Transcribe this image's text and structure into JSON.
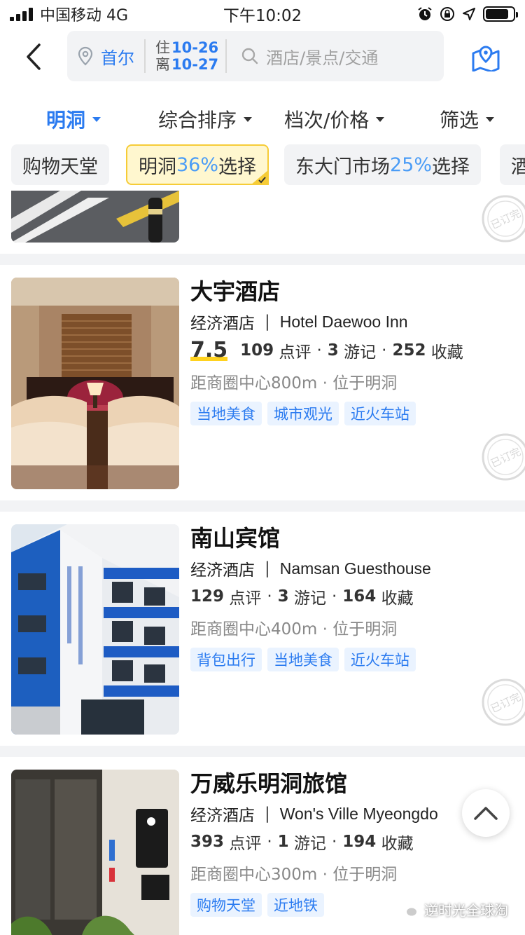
{
  "status_bar": {
    "carrier": "中国移动 4G",
    "time": "下午10:02"
  },
  "nav": {
    "city": "首尔",
    "checkin_label": "住",
    "checkin_date": "10-26",
    "checkout_label": "离",
    "checkout_date": "10-27",
    "search_placeholder": "酒店/景点/交通"
  },
  "filters": [
    {
      "label": "明洞",
      "active": true
    },
    {
      "label": "综合排序",
      "active": false
    },
    {
      "label": "档次/价格",
      "active": false
    },
    {
      "label": "筛选",
      "active": false
    }
  ],
  "chips": [
    {
      "label": "购物天堂"
    },
    {
      "label": "明洞",
      "pct": "36%",
      "suffix": "选择",
      "selected": true
    },
    {
      "label": "东大门市场",
      "pct": "25%",
      "suffix": "选择"
    },
    {
      "label": "酒"
    }
  ],
  "hotels": [
    {
      "name": "大宇酒店",
      "type": "经济酒店",
      "sep": "|",
      "en_name": "Hotel Daewoo Inn",
      "score": "7.5",
      "reviews": "109",
      "reviews_unit": "点评",
      "notes": "3",
      "notes_unit": "游记",
      "favs": "252",
      "favs_unit": "收藏",
      "distance": "距商圈中心800m · 位于明洞",
      "tags": [
        "当地美食",
        "城市观光",
        "近火车站"
      ]
    },
    {
      "name": "南山宾馆",
      "type": "经济酒店",
      "sep": "|",
      "en_name": "Namsan Guesthouse",
      "reviews": "129",
      "reviews_unit": "点评",
      "notes": "3",
      "notes_unit": "游记",
      "favs": "164",
      "favs_unit": "收藏",
      "distance": "距商圈中心400m · 位于明洞",
      "tags": [
        "背包出行",
        "当地美食",
        "近火车站"
      ]
    },
    {
      "name": "万威乐明洞旅馆",
      "type": "经济酒店",
      "sep": "|",
      "en_name": "Won's Ville Myeongdo",
      "reviews": "393",
      "reviews_unit": "点评",
      "notes": "1",
      "notes_unit": "游记",
      "favs": "194",
      "favs_unit": "收藏",
      "distance": "距商圈中心300m · 位于明洞",
      "tags": [
        "购物天堂",
        "近地铁"
      ]
    }
  ],
  "stamp_text": "已订完",
  "watermark": "逆时光全球淘",
  "colors": {
    "accent": "#2b7bf0",
    "score_highlight": "#ffd21f",
    "chip_selected_bg": "#fff7cf"
  }
}
